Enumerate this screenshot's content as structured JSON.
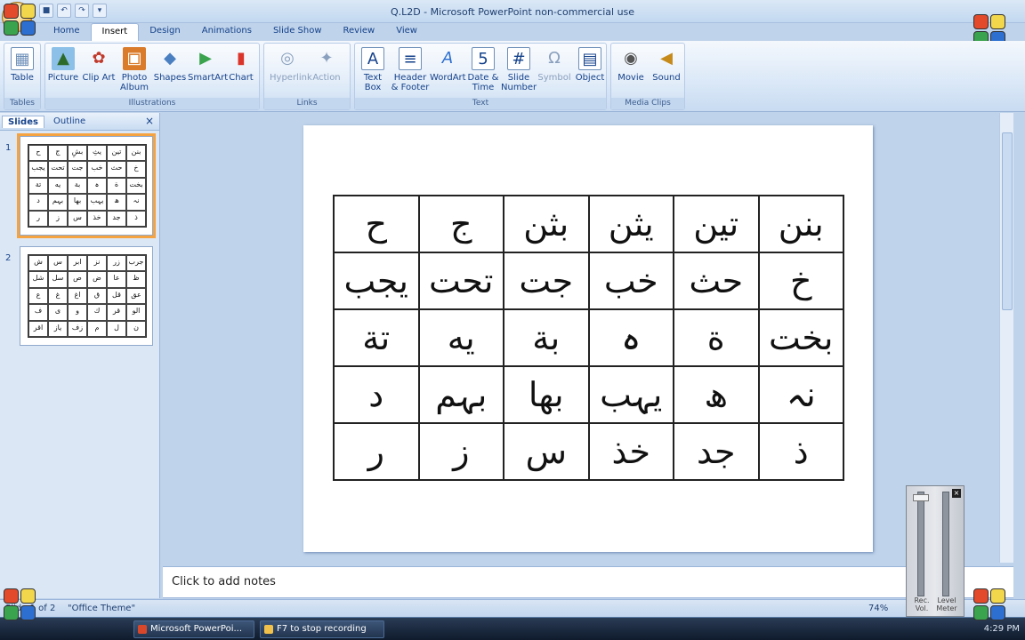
{
  "window": {
    "title": "Q.L2D - Microsoft PowerPoint non-commercial use"
  },
  "quick_access": [
    "save-icon",
    "undo-icon",
    "redo-icon",
    "dropdown-icon"
  ],
  "tabs": [
    "Home",
    "Insert",
    "Design",
    "Animations",
    "Slide Show",
    "Review",
    "View"
  ],
  "ribbon": {
    "groups": {
      "tables": "Tables",
      "illustrations": "Illustrations",
      "links": "Links",
      "text": "Text",
      "media": "Media Clips"
    },
    "buttons": {
      "table": "Table",
      "picture": "Picture",
      "clipart": "Clip Art",
      "photo": "Photo Album",
      "shapes": "Shapes",
      "smartart": "SmartArt",
      "chart": "Chart",
      "hyperlink": "Hyperlink",
      "action": "Action",
      "textbox": "Text Box",
      "header": "Header & Footer",
      "wordart": "WordArt",
      "datetime": "Date & Time",
      "slidenum": "Slide Number",
      "symbol": "Symbol",
      "object": "Object",
      "movie": "Movie",
      "sound": "Sound"
    }
  },
  "panel": {
    "tab_slides": "Slides",
    "tab_outline": "Outline",
    "close": "×",
    "slide_numbers": [
      "1",
      "2"
    ]
  },
  "thumb1": [
    "ح",
    "ج",
    "بشِ",
    "يثِ",
    "تين",
    "بنن",
    "يجب",
    "تحت",
    "جت",
    "خب",
    "حث",
    "خ",
    "تة",
    "يه",
    "بة",
    "ہ",
    "ة",
    "بخت",
    "د",
    "بہم",
    "بھا",
    "یہب",
    "ھ",
    "نہ",
    "ر",
    "ز",
    "س",
    "خذ",
    "جد",
    "ذ"
  ],
  "thumb2": [
    "ش",
    "س",
    "ابر",
    "نز",
    "زر",
    "جرب",
    "شل",
    "سل",
    "ص",
    "ض",
    "عا",
    "ظ",
    "ع",
    "غ",
    "اغ",
    "ق",
    "قل",
    "عق",
    "ف",
    "ی",
    "و",
    "ك",
    "قر",
    "الو",
    "اقر",
    "یاز",
    "زف",
    "م",
    "ل",
    "ن"
  ],
  "slide_grid": [
    "ح",
    "ج",
    "بثن",
    "يثن",
    "تين",
    "بنن",
    "يجب",
    "تحت",
    "جت",
    "خب",
    "حث",
    "خ",
    "تة",
    "يه",
    "بة",
    "ہ",
    "ة",
    "بخت",
    "د",
    "بہم",
    "بھا",
    "یہب",
    "ھ",
    "نہ",
    "ر",
    "ز",
    "س",
    "خذ",
    "جد",
    "ذ"
  ],
  "notes": {
    "placeholder": "Click to add notes"
  },
  "status": {
    "slide": "Slide 1 of 2",
    "theme": "\"Office Theme\"",
    "zoom": "74%"
  },
  "recorder": {
    "rec_label": "Rec. Vol.",
    "level_label": "Level Meter",
    "close": "×"
  },
  "taskbar": {
    "ppt": "Microsoft PowerPoi...",
    "rec": "F7 to stop recording",
    "clock": "4:29 PM"
  },
  "colors": {
    "ribbon": "#d6e5f6",
    "selection": "#f5a341",
    "frame": "#bfd3ea"
  }
}
